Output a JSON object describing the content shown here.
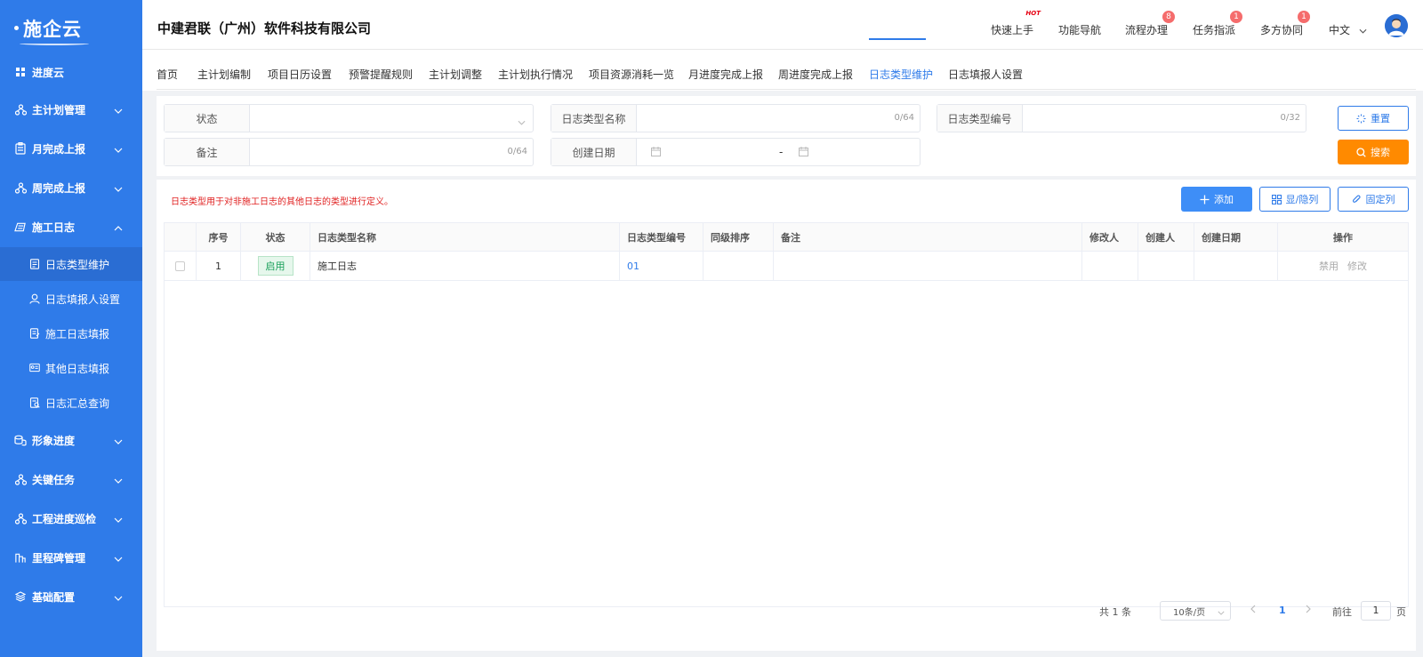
{
  "logo": {
    "text": "施企云"
  },
  "sidebar": {
    "items": [
      {
        "label": "进度云",
        "icon": "grid-icon"
      },
      {
        "label": "主计划管理",
        "icon": "hierarchy-icon"
      },
      {
        "label": "月完成上报",
        "icon": "clipboard-icon"
      },
      {
        "label": "周完成上报",
        "icon": "hierarchy-icon"
      },
      {
        "label": "施工日志",
        "icon": "log-icon",
        "expanded": true
      },
      {
        "label": "形象进度",
        "icon": "coins-icon"
      },
      {
        "label": "关键任务",
        "icon": "hierarchy-icon"
      },
      {
        "label": "工程进度巡检",
        "icon": "hierarchy-icon"
      },
      {
        "label": "里程碑管理",
        "icon": "milestone-icon"
      },
      {
        "label": "基础配置",
        "icon": "layers-icon"
      }
    ],
    "sub_items": [
      {
        "label": "日志类型维护",
        "active": true
      },
      {
        "label": "日志填报人设置"
      },
      {
        "label": "施工日志填报"
      },
      {
        "label": "其他日志填报"
      },
      {
        "label": "日志汇总查询"
      }
    ]
  },
  "header": {
    "company": "中建君联（广州）软件科技有限公司",
    "quick_start": "快速上手",
    "hot_tag": "HOT",
    "nav_guide": "功能导航",
    "workflow": "流程办理",
    "workflow_badge": "8",
    "task_assign": "任务指派",
    "task_badge": "1",
    "collab": "多方协同",
    "collab_badge": "1",
    "language": "中文"
  },
  "tabs": [
    "首页",
    "主计划编制",
    "项目日历设置",
    "预警提醒规则",
    "主计划调整",
    "主计划执行情况",
    "项目资源消耗一览",
    "月进度完成上报",
    "周进度完成上报",
    "日志类型维护",
    "日志填报人设置"
  ],
  "active_tab": "日志类型维护",
  "filter": {
    "status_label": "状态",
    "name_label": "日志类型名称",
    "name_count": "0/64",
    "code_label": "日志类型编号",
    "code_count": "0/32",
    "remark_label": "备注",
    "remark_count": "0/64",
    "date_label": "创建日期",
    "date_sep": "-",
    "reset_label": "重置",
    "search_label": "搜索"
  },
  "toolbar": {
    "notice": "日志类型用于对非施工日志的其他日志的类型进行定义。",
    "add_label": "添加",
    "columns_label": "显/隐列",
    "fix_label": "固定列"
  },
  "table": {
    "headers": {
      "index": "序号",
      "status": "状态",
      "name": "日志类型名称",
      "code": "日志类型编号",
      "sort": "同级排序",
      "remark": "备注",
      "modifier": "修改人",
      "creator": "创建人",
      "created": "创建日期",
      "ops": "操作"
    },
    "rows": [
      {
        "index": "1",
        "status": "启用",
        "name": "施工日志",
        "code": "01",
        "sort": "",
        "remark": "",
        "modifier": "",
        "creator": "",
        "created": "",
        "op_disable": "禁用",
        "op_edit": "修改"
      }
    ]
  },
  "pagination": {
    "total": "共 1 条",
    "page_size": "10条/页",
    "current": "1",
    "goto_label": "前往",
    "goto_value": "1",
    "page_unit": "页"
  },
  "colors": {
    "sidebar": "#2f7be9",
    "accent": "#2f7be9",
    "search": "#ff8a00",
    "add": "#3e8ef7",
    "notice": "#e02020"
  }
}
